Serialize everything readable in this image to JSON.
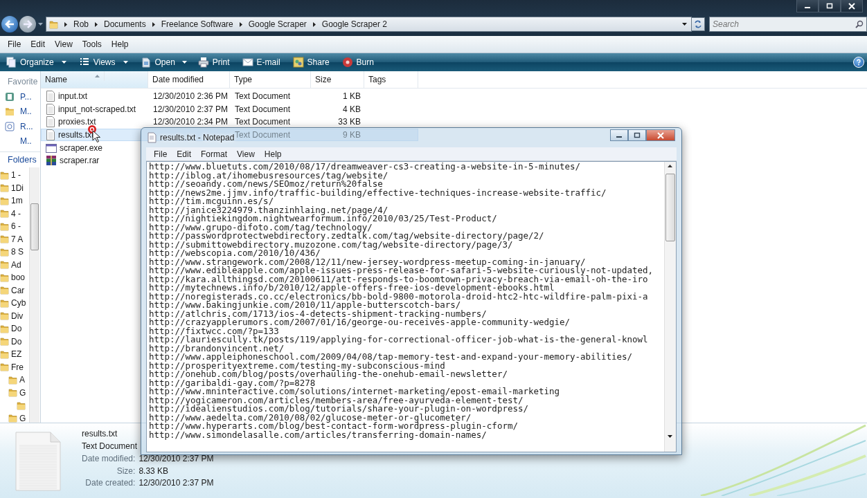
{
  "explorer": {
    "breadcrumbs": [
      "Rob",
      "Documents",
      "Freelance Software",
      "Google Scraper",
      "Google Scraper 2"
    ],
    "search": {
      "placeholder": "Search"
    },
    "menu": [
      "File",
      "Edit",
      "View",
      "Tools",
      "Help"
    ],
    "toolbar": [
      {
        "label": "Organize",
        "kind": "menu"
      },
      {
        "label": "Views",
        "kind": "menu"
      },
      {
        "label": "Open",
        "kind": "split"
      },
      {
        "label": "Print",
        "kind": "button"
      },
      {
        "label": "E-mail",
        "kind": "button"
      },
      {
        "label": "Share",
        "kind": "button"
      },
      {
        "label": "Burn",
        "kind": "button"
      }
    ],
    "nav": {
      "favorites_title": "Favorite",
      "favorites": [
        "P...",
        "M..",
        "R...",
        "M.."
      ],
      "folders_title": "Folders",
      "folders": [
        {
          "label": "1 -"
        },
        {
          "label": "1Di"
        },
        {
          "label": "1m"
        },
        {
          "label": "4 -"
        },
        {
          "label": "6 -"
        },
        {
          "label": "7 A"
        },
        {
          "label": "8 S"
        },
        {
          "label": "Ad"
        },
        {
          "label": "boo"
        },
        {
          "label": "Car"
        },
        {
          "label": "Cyb"
        },
        {
          "label": "Div"
        },
        {
          "label": "Do"
        },
        {
          "label": "Do"
        },
        {
          "label": "EZ"
        },
        {
          "label": "Fre",
          "children": [
            {
              "label": "A"
            },
            {
              "label": "G",
              "children": [
                {
                  "kind": "folder"
                }
              ]
            },
            {
              "label": "G"
            }
          ]
        }
      ]
    },
    "columns": [
      "Name",
      "Date modified",
      "Type",
      "Size",
      "Tags"
    ],
    "files": [
      {
        "name": "input.txt",
        "kind": "text",
        "date": "12/30/2010 2:36 PM",
        "type": "Text Document",
        "size": "1 KB",
        "selected": false
      },
      {
        "name": "input_not-scraped.txt",
        "kind": "text",
        "date": "12/30/2010 2:37 PM",
        "type": "Text Document",
        "size": "4 KB",
        "selected": false
      },
      {
        "name": "proxies.txt",
        "kind": "text",
        "date": "12/30/2010 2:34 PM",
        "type": "Text Document",
        "size": "33 KB",
        "selected": false
      },
      {
        "name": "results.txt",
        "kind": "text",
        "type": "Text Document",
        "size": "9 KB",
        "selected": true
      },
      {
        "name": "scraper.exe",
        "kind": "exe",
        "selected": false
      },
      {
        "name": "scraper.rar",
        "kind": "rar",
        "selected": false
      }
    ],
    "details": {
      "name": "results.txt",
      "type": "Text Document",
      "fields": [
        {
          "label": "Date modified:",
          "value": "12/30/2010 2:37 PM"
        },
        {
          "label": "Size:",
          "value": "8.33 KB"
        },
        {
          "label": "Date created:",
          "value": "12/30/2010 2:37 PM"
        }
      ]
    }
  },
  "notepad": {
    "title": "results.txt - Notepad",
    "menu": [
      "File",
      "Edit",
      "Format",
      "View",
      "Help"
    ],
    "lines": [
      "http://www.bluetuts.com/2010/08/17/dreamweaver-cs3-creating-a-website-in-5-minutes/",
      "http://iblog.at/ihomebusresources/tag/website/",
      "http://seoandy.com/news/SEOmoz/return%20false",
      "http://news2me.jjmv.info/traffic-building/effective-techniques-increase-website-traffic/",
      "http://tim.mcguinn.es/s/",
      "http://janice3224979.thanzinhlaing.net/page/4/",
      "http://nightiekingdom.nightwearformum.info/2010/03/25/Test-Product/",
      "http://www.grupo-difoto.com/tag/technology/",
      "http://passwordprotectwebdirectory.zedtalk.com/tag/website-directory/page/2/",
      "http://submittowebdirectory.muzozone.com/tag/website-directory/page/3/",
      "http://webscopia.com/2010/10/436/",
      "http://www.strangework.com/2008/12/11/new-jersey-wordpress-meetup-coming-in-january/",
      "http://www.edibleapple.com/apple-issues-press-release-for-safari-5-website-curiously-not-updated,",
      "http://kara.allthingsd.com/20100611/att-responds-to-boomtown-privacy-breach-via-email-oh-the-iro",
      "http://mytechnews.info/b/2010/12/apple-offers-free-ios-development-ebooks.html",
      "http://noregisterads.co.cc/electronics/bb-bold-9800-motorola-droid-htc2-htc-wildfire-palm-pixi-a",
      "http://www.bakingjunkie.com/2010/11/apple-butterscotch-bars/",
      "http://atlchris.com/1713/ios-4-detects-shipment-tracking-numbers/",
      "http://crazyapplerumors.com/2007/01/16/george-ou-receives-apple-community-wedgie/",
      "http://fixtwcc.com/?p=133",
      "http://lauriescully.tk/posts/119/applying-for-correctional-officer-job-what-is-the-general-knowl",
      "http://brandonvincent.net/",
      "http://www.appleiphoneschool.com/2009/04/08/tap-memory-test-and-expand-your-memory-abilities/",
      "http://prosperityextreme.com/testing-my-subconscious-mind",
      "http://onehub.com/blog/posts/overhauling-the-onehub-email-newsletter/",
      "http://garibaldi-gay.com/?p=8278",
      "http://www.mninteractive.com/solutions/internet-marketing/epost-email-marketing",
      "http://yogicameron.com/articles/members-area/free-ayurveda-element-test/",
      "http://idealienstudios.com/blog/tutorials/share-your-plugin-on-wordpress/",
      "http://www.aedelta.com/2010/08/02/glucose-meter-or-glucometer/",
      "http://www.hyperarts.com/blog/best-contact-form-wordpress-plugin-cform/",
      "http://www.simondelasalle.com/articles/transferring-domain-names/"
    ]
  }
}
